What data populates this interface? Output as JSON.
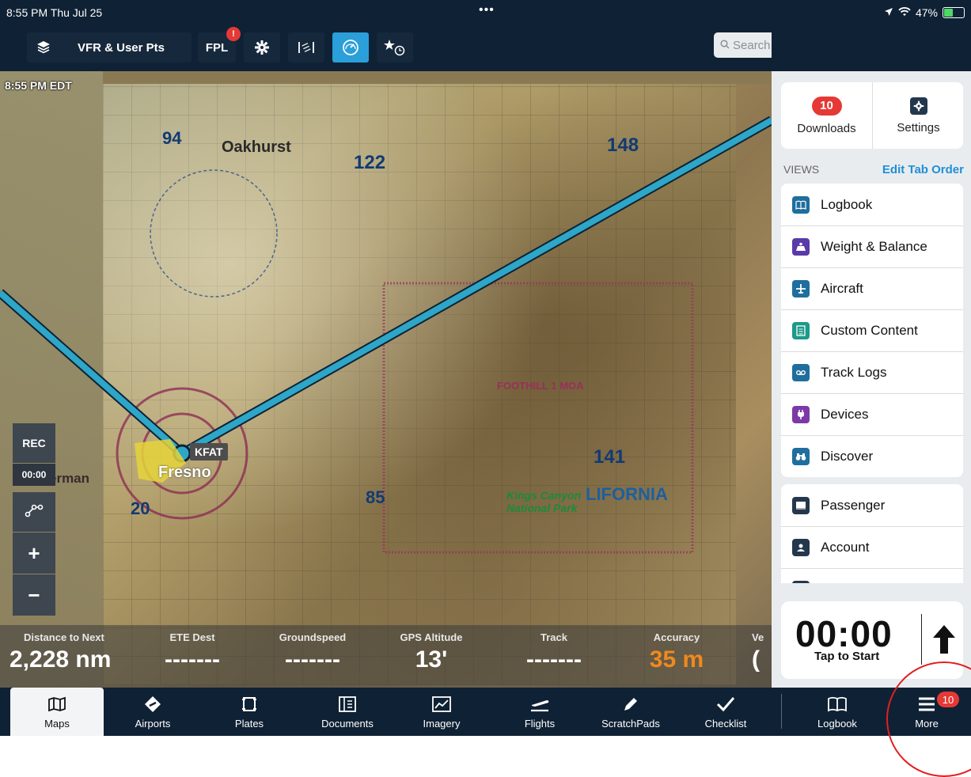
{
  "status_bar": {
    "time": "8:55 PM  Thu Jul 25",
    "dots": "•••",
    "battery": "47%",
    "icons": [
      "location-arrow-icon",
      "wifi-icon",
      "battery-charging-icon"
    ]
  },
  "toolbar": {
    "layers_label": "VFR & User Pts",
    "fpl_label": "FPL",
    "fpl_badge": "!",
    "search_placeholder": "Search"
  },
  "map": {
    "time_label": "8:55 PM EDT",
    "airport_label": "KFAT",
    "labels": [
      "Oakhurst",
      "Fresno",
      "erman",
      "FOOTHILL 1 MOA",
      "LIFORNIA",
      "Kings Canyon National Park"
    ],
    "numbers": [
      "94",
      "122",
      "148",
      "85",
      "141",
      "20"
    ]
  },
  "map_controls": {
    "rec": "REC",
    "rec_time": "00:00",
    "zoom_in": "+",
    "zoom_out": "−"
  },
  "instruments": [
    {
      "label": "Distance to Next",
      "value": "2,228 nm",
      "color": "#ffffff"
    },
    {
      "label": "ETE Dest",
      "value": "-------",
      "color": "#ffffff"
    },
    {
      "label": "Groundspeed",
      "value": "-------",
      "color": "#ffffff"
    },
    {
      "label": "GPS Altitude",
      "value": "13'",
      "color": "#ffffff"
    },
    {
      "label": "Track",
      "value": "-------",
      "color": "#ffffff"
    },
    {
      "label": "Accuracy",
      "value": "35 m",
      "color": "#f0891d"
    },
    {
      "label": "Ve",
      "value": "(",
      "color": "#ffffff"
    }
  ],
  "panel": {
    "downloads_count": "10",
    "downloads_label": "Downloads",
    "settings_label": "Settings",
    "views_label": "VIEWS",
    "edit_label": "Edit Tab Order",
    "views": [
      {
        "label": "Logbook",
        "icon": "book-icon",
        "color": "#1f6e9e"
      },
      {
        "label": "Weight & Balance",
        "icon": "weight-icon",
        "color": "#5a3aa8"
      },
      {
        "label": "Aircraft",
        "icon": "airplane-icon",
        "color": "#1f6e9e"
      },
      {
        "label": "Custom Content",
        "icon": "document-icon",
        "color": "#1c9a8a"
      },
      {
        "label": "Track Logs",
        "icon": "tracklog-icon",
        "color": "#1f6e9e"
      },
      {
        "label": "Devices",
        "icon": "plug-icon",
        "color": "#7b3aa8"
      },
      {
        "label": "Discover",
        "icon": "binoculars-icon",
        "color": "#1f6e9e"
      }
    ],
    "extras": [
      {
        "label": "Passenger",
        "icon": "passenger-icon",
        "color": "#24384d"
      },
      {
        "label": "Account",
        "icon": "account-icon",
        "color": "#24384d"
      }
    ],
    "timer_value": "00:00",
    "timer_label": "Tap to Start"
  },
  "tabs": [
    {
      "label": "Maps",
      "icon": "map-icon",
      "active": true
    },
    {
      "label": "Airports",
      "icon": "airport-icon",
      "active": false
    },
    {
      "label": "Plates",
      "icon": "plates-icon",
      "active": false
    },
    {
      "label": "Documents",
      "icon": "documents-icon",
      "active": false
    },
    {
      "label": "Imagery",
      "icon": "imagery-icon",
      "active": false
    },
    {
      "label": "Flights",
      "icon": "flights-icon",
      "active": false
    },
    {
      "label": "ScratchPads",
      "icon": "pencil-icon",
      "active": false
    },
    {
      "label": "Checklist",
      "icon": "checkmark-icon",
      "active": false
    },
    {
      "label": "Logbook",
      "icon": "book-icon",
      "active": false
    },
    {
      "label": "More",
      "icon": "menu-icon",
      "active": false
    }
  ],
  "more_badge": "10"
}
